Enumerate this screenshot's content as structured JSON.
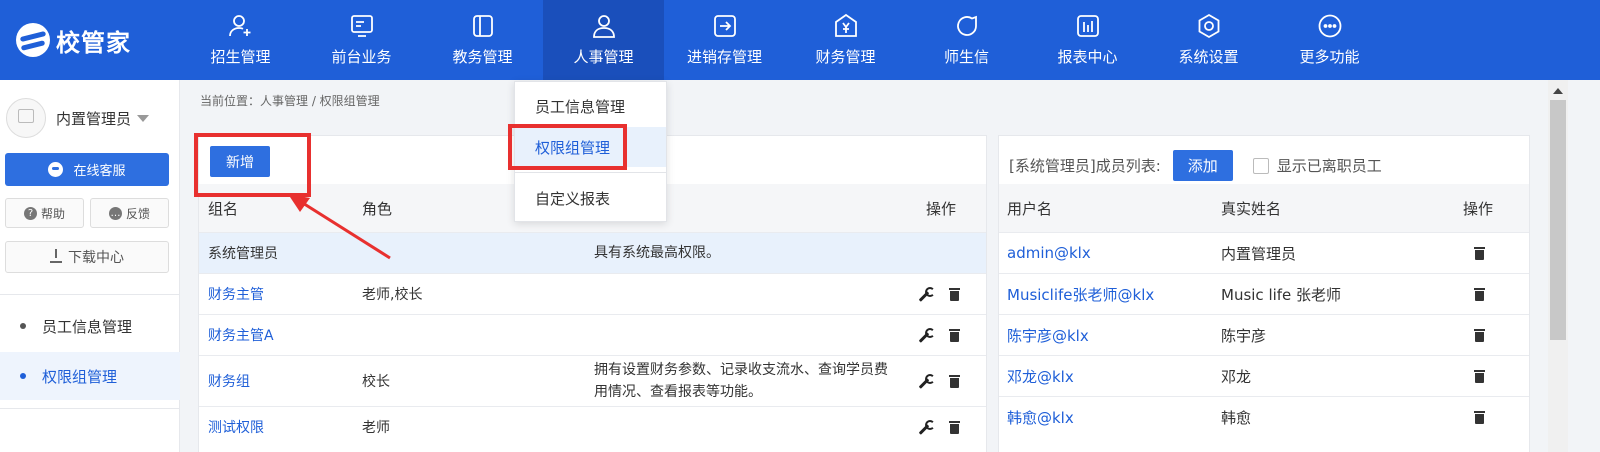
{
  "app": {
    "logo_text": "校管家"
  },
  "nav": [
    {
      "label": "招生管理",
      "icon": "user-add-icon"
    },
    {
      "label": "前台业务",
      "icon": "desk-icon"
    },
    {
      "label": "教务管理",
      "icon": "book-icon"
    },
    {
      "label": "人事管理",
      "icon": "person-icon"
    },
    {
      "label": "进销存管理",
      "icon": "inventory-icon"
    },
    {
      "label": "财务管理",
      "icon": "finance-icon"
    },
    {
      "label": "师生信",
      "icon": "chat-icon"
    },
    {
      "label": "报表中心",
      "icon": "report-icon"
    },
    {
      "label": "系统设置",
      "icon": "settings-icon"
    },
    {
      "label": "更多功能",
      "icon": "more-icon"
    }
  ],
  "nav_active": "人事管理",
  "dropdown": {
    "items": [
      "员工信息管理",
      "权限组管理",
      "自定义报表"
    ],
    "active": "权限组管理"
  },
  "sidebar": {
    "user_name": "内置管理员",
    "service_label": "在线客服",
    "help_label": "帮助",
    "feedback_label": "反馈",
    "download_label": "下载中心",
    "menu": [
      "员工信息管理",
      "权限组管理"
    ],
    "menu_active": "权限组管理"
  },
  "breadcrumb": "当前位置：人事管理 / 权限组管理",
  "groups": {
    "add_label": "新增",
    "columns": [
      "组名",
      "角色",
      "操作"
    ],
    "rows": [
      {
        "name": "系统管理员",
        "role": "",
        "desc": "具有系统最高权限。"
      },
      {
        "name": "财务主管",
        "role": "老师,校长",
        "desc": ""
      },
      {
        "name": "财务主管A",
        "role": "",
        "desc": ""
      },
      {
        "name": "财务组",
        "role": "校长",
        "desc": "拥有设置财务参数、记录收支流水、查询学员费用情况、查看报表等功能。"
      },
      {
        "name": "测试权限",
        "role": "老师",
        "desc": ""
      }
    ]
  },
  "members": {
    "title": "[系统管理员]成员列表:",
    "add_label": "添加",
    "show_resigned_label": "显示已离职员工",
    "columns": [
      "用户名",
      "真实姓名",
      "操作"
    ],
    "rows": [
      {
        "username": "admin@klx",
        "realname": "内置管理员"
      },
      {
        "username": "Musiclife张老师@klx",
        "realname": "Music life 张老师"
      },
      {
        "username": "陈宇彦@klx",
        "realname": "陈宇彦"
      },
      {
        "username": "邓龙@klx",
        "realname": "邓龙"
      },
      {
        "username": "韩愈@klx",
        "realname": "韩愈"
      }
    ]
  },
  "colors": {
    "primary": "#1f5fd8",
    "annotation_red": "#e8302f"
  }
}
